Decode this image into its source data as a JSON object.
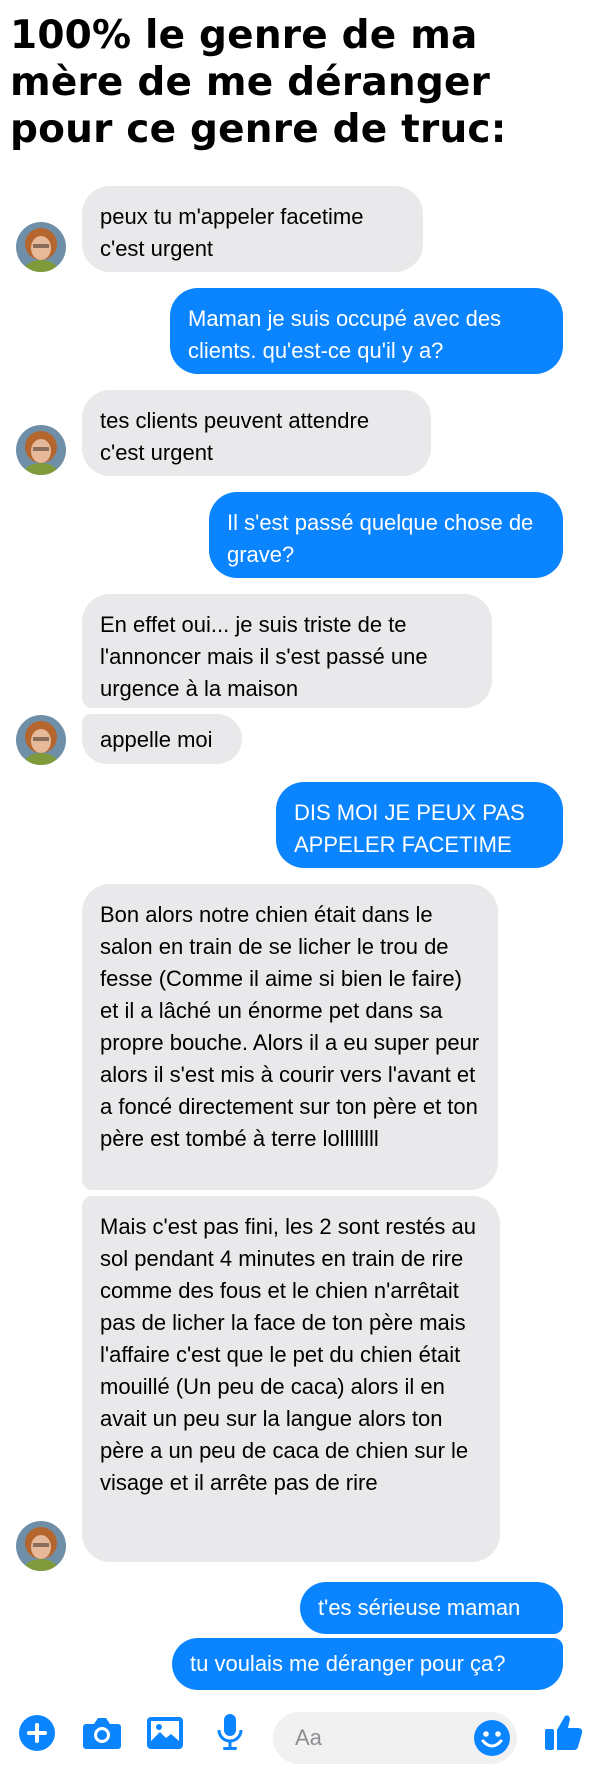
{
  "header": {
    "title": "100% le genre de ma mère de me déranger pour ce genre de truc:"
  },
  "messages": [
    {
      "sender": "mom",
      "text": "peux tu m'appeler facetime\nc'est urgent"
    },
    {
      "sender": "me",
      "text": "Maman je suis occupé avec des clients. qu'est-ce qu'il y a?"
    },
    {
      "sender": "mom",
      "text": "tes clients peuvent attendre\nc'est urgent"
    },
    {
      "sender": "me",
      "text": "Il s'est passé quelque chose de grave?"
    },
    {
      "sender": "mom",
      "text": "En effet oui... je suis triste de te l'annoncer mais il s'est passé une urgence à la maison"
    },
    {
      "sender": "mom",
      "text": "appelle moi"
    },
    {
      "sender": "me",
      "text": "DIS MOI JE PEUX PAS APPELER FACETIME"
    },
    {
      "sender": "mom",
      "text": "Bon alors notre chien était dans le salon en train de se licher le trou de fesse (Comme il aime si bien le faire) et il a lâché un énorme pet dans sa propre bouche. Alors il a eu super peur alors il s'est mis à courir vers l'avant et a foncé directement sur ton père et ton père est tombé à terre lollllllll"
    },
    {
      "sender": "mom",
      "text": "Mais c'est pas fini, les 2 sont restés au sol pendant 4 minutes en train de rire comme des fous et le chien n'arrêtait pas de licher la face de ton père mais l'affaire c'est que le pet du chien était mouillé (Un peu de caca) alors il en avait un peu sur la langue alors ton père a un peu de caca de chien sur le visage et il arrête pas de rire"
    },
    {
      "sender": "me",
      "text": "t'es sérieuse maman"
    },
    {
      "sender": "me",
      "text": "tu voulais me déranger pour ça?"
    }
  ],
  "composer": {
    "placeholder": "Aa"
  },
  "toolbar_icons": [
    "plus-icon",
    "camera-icon",
    "image-icon",
    "microphone-icon",
    "emoji-icon",
    "thumbs-up-icon"
  ],
  "colors": {
    "outgoing_bubble": "#0a84ff",
    "incoming_bubble": "#e9e9eb",
    "accent": "#0a84ff"
  }
}
